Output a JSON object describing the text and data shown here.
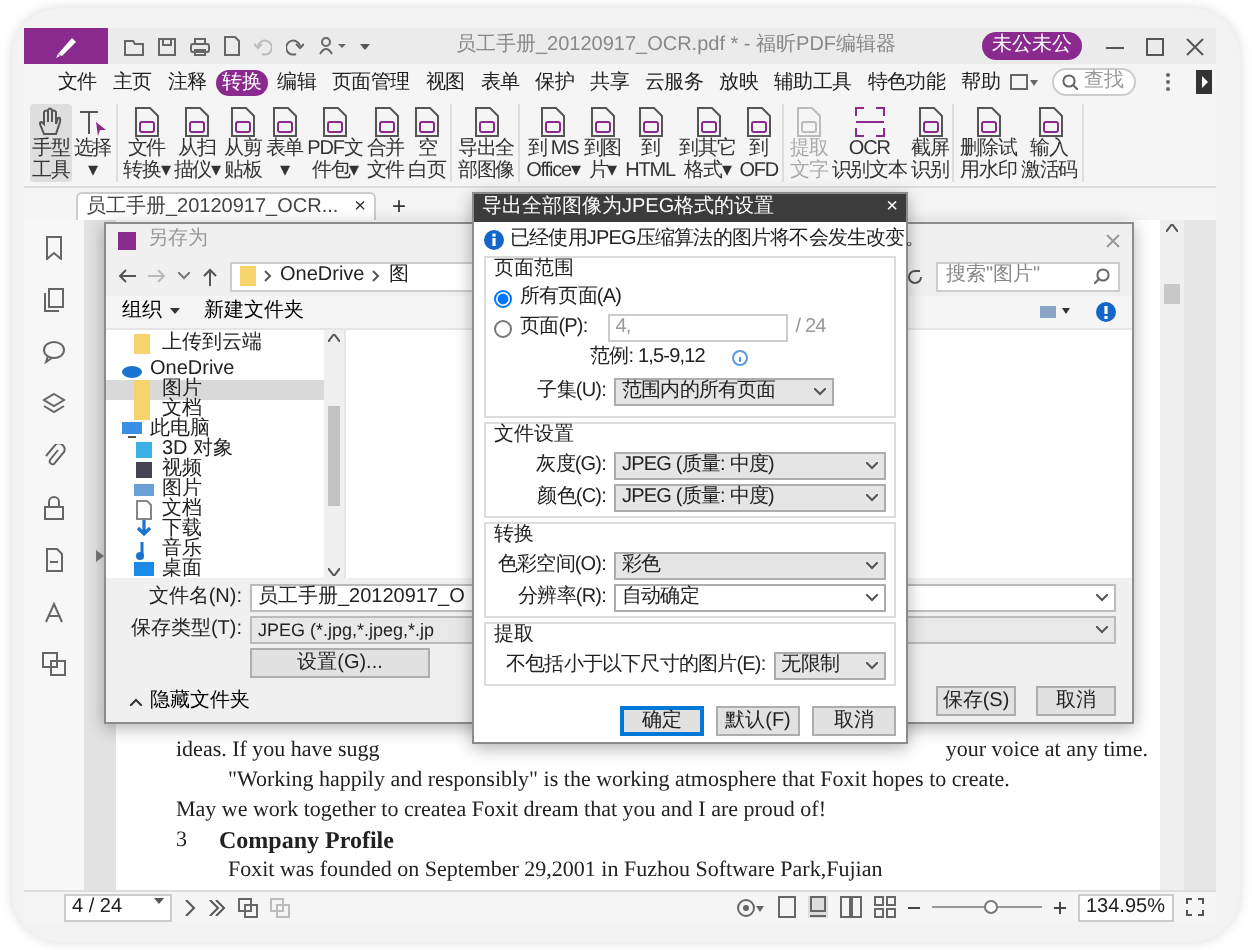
{
  "window": {
    "title": "员工手册_20120917_OCR.pdf * - 福昕PDF编辑器",
    "user": "未公未公"
  },
  "menu": [
    {
      "label": "文件",
      "selected": false
    },
    {
      "label": "主页",
      "selected": false
    },
    {
      "label": "注释",
      "selected": false
    },
    {
      "label": "转换",
      "selected": true
    },
    {
      "label": "编辑",
      "selected": false
    },
    {
      "label": "页面管理",
      "selected": false
    },
    {
      "label": "视图",
      "selected": false
    },
    {
      "label": "表单",
      "selected": false
    },
    {
      "label": "保护",
      "selected": false
    },
    {
      "label": "共享",
      "selected": false
    },
    {
      "label": "云服务",
      "selected": false
    },
    {
      "label": "放映",
      "selected": false
    },
    {
      "label": "辅助工具",
      "selected": false
    },
    {
      "label": "特色功能",
      "selected": false
    },
    {
      "label": "帮助",
      "selected": false
    }
  ],
  "search": {
    "placeholder": "查找"
  },
  "ribbon": [
    [
      {
        "lines": [
          "手型",
          "工具"
        ],
        "selected": true,
        "disabled": false
      },
      {
        "lines": [
          "选择",
          "▾"
        ],
        "selected": false,
        "disabled": false
      }
    ],
    [
      {
        "lines": [
          "文件",
          "转换▾"
        ],
        "selected": false,
        "disabled": false
      },
      {
        "lines": [
          "从扫",
          "描仪▾"
        ],
        "selected": false,
        "disabled": false
      },
      {
        "lines": [
          "从剪",
          "贴板"
        ],
        "selected": false,
        "disabled": false
      },
      {
        "lines": [
          "表单",
          "▾"
        ],
        "selected": false,
        "disabled": false
      },
      {
        "lines": [
          "PDF文",
          "件包▾"
        ],
        "selected": false,
        "disabled": false
      },
      {
        "lines": [
          "合并",
          "文件"
        ],
        "selected": false,
        "disabled": false
      },
      {
        "lines": [
          "空",
          "白页"
        ],
        "selected": false,
        "disabled": false
      }
    ],
    [
      {
        "lines": [
          "导出全",
          "部图像"
        ],
        "selected": false,
        "disabled": false
      }
    ],
    [
      {
        "lines": [
          "到 MS",
          "Office▾"
        ],
        "selected": false,
        "disabled": false
      },
      {
        "lines": [
          "到图",
          "片▾"
        ],
        "selected": false,
        "disabled": false
      },
      {
        "lines": [
          "到",
          "HTML"
        ],
        "selected": false,
        "disabled": false
      },
      {
        "lines": [
          "到其它",
          "格式▾"
        ],
        "selected": false,
        "disabled": false
      },
      {
        "lines": [
          "到",
          "OFD"
        ],
        "selected": false,
        "disabled": false
      }
    ],
    [
      {
        "lines": [
          "提取",
          "文字"
        ],
        "selected": false,
        "disabled": true
      },
      {
        "lines": [
          "OCR",
          "识别文本"
        ],
        "selected": false,
        "disabled": false
      },
      {
        "lines": [
          "截屏",
          "识别"
        ],
        "selected": false,
        "disabled": false
      }
    ],
    [
      {
        "lines": [
          "删除试",
          "用水印"
        ],
        "selected": false,
        "disabled": false
      },
      {
        "lines": [
          "输入",
          "激活码"
        ],
        "selected": false,
        "disabled": false
      }
    ]
  ],
  "doc_tab": {
    "title": "员工手册_20120917_OCR...",
    "close": "×",
    "add": "+"
  },
  "document": {
    "lines": [
      {
        "kind": "split",
        "left": "ideas. If you have sugg",
        "right": "your voice at any time."
      },
      {
        "kind": "para",
        "indent": true,
        "text": "\"Working happily and responsibly\" is the working atmosphere that Foxit hopes to create."
      },
      {
        "kind": "para",
        "indent": false,
        "text": "May we work together to createa Foxit dream that you and I are proud of!"
      },
      {
        "kind": "heading",
        "number": "3",
        "text": "Company Profile"
      },
      {
        "kind": "para",
        "indent": true,
        "text": "Foxit  was founded on September 29,2001 in Fuzhou Software Park,Fujian"
      }
    ]
  },
  "status_bar": {
    "page": "4 / 24",
    "zoom_slider": {
      "level": 0.53
    },
    "zoom": "134.95%"
  },
  "save_dialog": {
    "title": "另存为",
    "path": [
      "OneDrive",
      "图"
    ],
    "search_placeholder": "搜索\"图片\"",
    "toolbar": [
      "组织",
      "新建文件夹"
    ],
    "nav": [
      {
        "label": "上传到云端",
        "kind": "folder",
        "selected": false
      },
      {
        "label": "OneDrive",
        "kind": "cloud",
        "selected": false
      },
      {
        "label": "图片",
        "kind": "folder",
        "selected": true
      },
      {
        "label": "文档",
        "kind": "folder",
        "selected": false
      },
      {
        "label": "此电脑",
        "kind": "computer",
        "selected": false
      },
      {
        "label": "3D 对象",
        "kind": "cube",
        "selected": false
      },
      {
        "label": "视频",
        "kind": "video",
        "selected": false
      },
      {
        "label": "图片",
        "kind": "image",
        "selected": false
      },
      {
        "label": "文档",
        "kind": "document",
        "selected": false
      },
      {
        "label": "下载",
        "kind": "download",
        "selected": false
      },
      {
        "label": "音乐",
        "kind": "music",
        "selected": false
      },
      {
        "label": "桌面",
        "kind": "desktop",
        "selected": false
      }
    ],
    "fields": [
      {
        "label": "文件名(N):",
        "value": "员工手册_20120917_O",
        "editable": true
      },
      {
        "label": "保存类型(T):",
        "value": "JPEG (*.jpg,*.jpeg,*.jp",
        "editable": false
      }
    ],
    "settings_button": "设置(G)...",
    "hide_folders": "隐藏文件夹",
    "buttons": [
      "保存(S)",
      "取消"
    ]
  },
  "export_dialog": {
    "title": "导出全部图像为JPEG格式的设置",
    "close": "×",
    "info": "已经使用JPEG压缩算法的图片将不会发生改变。",
    "page_range": {
      "legend": "页面范围",
      "options": [
        {
          "label": "所有页面(A)",
          "selected": true
        },
        {
          "label": "页面(P):",
          "selected": false
        }
      ],
      "pages_value": "4,",
      "pages_disabled": true,
      "total": "/ 24",
      "example": "范例: 1,5-9,12",
      "subset_label": "子集(U):",
      "subset_value": "范围内的所有页面"
    },
    "groups": [
      {
        "legend": "文件设置",
        "rows": [
          {
            "label": "灰度(G):",
            "value": "JPEG (质量: 中度)",
            "editable": false
          },
          {
            "label": "颜色(C):",
            "value": "JPEG (质量: 中度)",
            "editable": false
          }
        ]
      },
      {
        "legend": "转换",
        "rows": [
          {
            "label": "色彩空间(O):",
            "value": "彩色",
            "editable": false
          },
          {
            "label": "分辨率(R):",
            "value": "自动确定",
            "editable": true
          }
        ]
      },
      {
        "legend": "提取",
        "rows": [
          {
            "label": "不包括小于以下尺寸的图片(E):",
            "value": "无限制",
            "editable": false
          }
        ]
      }
    ],
    "buttons": [
      {
        "label": "确定",
        "default": true
      },
      {
        "label": "默认(F)",
        "default": false
      },
      {
        "label": "取消",
        "default": false
      }
    ]
  }
}
